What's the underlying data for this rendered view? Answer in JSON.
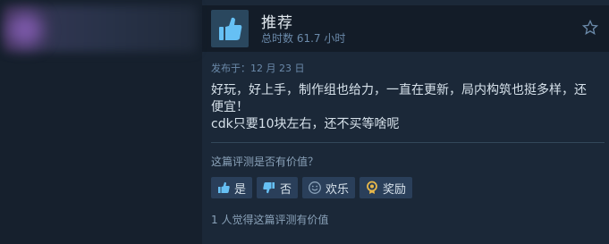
{
  "review": {
    "recommendation": "推荐",
    "hours": "总时数 61.7 小时",
    "posted": "发布于：12 月 23 日",
    "text_lines": [
      "好玩，好上手，制作组也给力，一直在更新，局内构筑也挺多样，还",
      "便宜！",
      "cdk只要10块左右，还不买等啥呢"
    ],
    "helpful_question": "这篇评测是否有价值？",
    "buttons": {
      "yes": "是",
      "no": "否",
      "funny": "欢乐",
      "award": "奖励"
    },
    "helpful_count": "1 人觉得这篇评测有价值"
  },
  "icons": {
    "recommend": "thumbs-up-icon",
    "star": "star-outline-icon",
    "yes": "thumbs-up-icon",
    "no": "thumbs-down-icon",
    "funny": "smiley-icon",
    "award": "award-medal-icon"
  },
  "colors": {
    "background": "#1b2838",
    "thumb_blue": "#66c0f4",
    "button_bg": "#2a3f5a",
    "award_gold": "#e8b84a"
  }
}
